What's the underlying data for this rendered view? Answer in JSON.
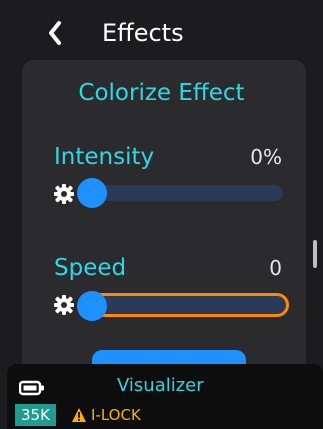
{
  "header": {
    "back_icon": "chevron-left-icon",
    "title": "Effects"
  },
  "panel": {
    "title": "Colorize Effect",
    "controls": [
      {
        "label": "Intensity",
        "value": "0%",
        "level": 0,
        "gear_icon": "gear-icon",
        "focused": false
      },
      {
        "label": "Speed",
        "value": "0",
        "level": 0,
        "gear_icon": "gear-icon",
        "focused": true
      }
    ]
  },
  "statusbar": {
    "title": "Visualizer",
    "badge": "35K",
    "warning": "I-LOCK",
    "warning_icon": "warning-triangle-icon",
    "battery_icon": "battery-icon"
  },
  "colors": {
    "accent": "#2ed6e6",
    "slider": "#1e90ff",
    "focus": "#ff8a00",
    "warning": "#ffb000",
    "badge": "#1f9c8f"
  }
}
